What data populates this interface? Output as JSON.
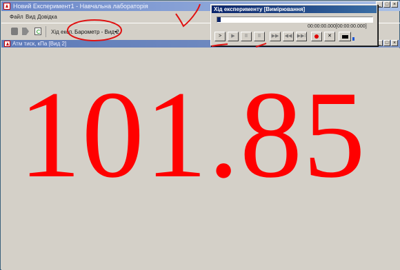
{
  "app": {
    "title": "Новий Експеримент1 - Навчальна лабораторія",
    "menu": [
      "Файл",
      "Вид",
      "Довідка"
    ],
    "toolbar": {
      "label": "Хід експ.",
      "sensor_select": "Барометр - Вид 2",
      "icons": [
        "print-icon",
        "stop-icon",
        "refresh-icon"
      ]
    }
  },
  "child_window": {
    "title": "Атм тиск, кПа [Вид 2]",
    "value": "101.85",
    "value_color": "#ff0000"
  },
  "experiment_window": {
    "title": "Хід експерименту [Вимірювання]",
    "time": "00:00:00.000[00:00:00.000]",
    "progress_fraction": 0.02,
    "buttons": [
      "play",
      "step",
      "pause",
      "pause2",
      "fast-forward",
      "rewind",
      "skip",
      "record",
      "delete",
      "stop"
    ],
    "glyphs": {
      "play": ">",
      "step": "▶",
      "pause": "II",
      "pause2": "II",
      "fast-forward": "▶▶",
      "rewind": "◀◀",
      "skip": "▶▶I",
      "delete": "✕"
    }
  },
  "window_controls": {
    "minimize": "_",
    "maximize": "□",
    "close": "×"
  },
  "colors": {
    "value": "#ff0000",
    "annotation": "#e01010",
    "titlebar": "#0a246a"
  }
}
